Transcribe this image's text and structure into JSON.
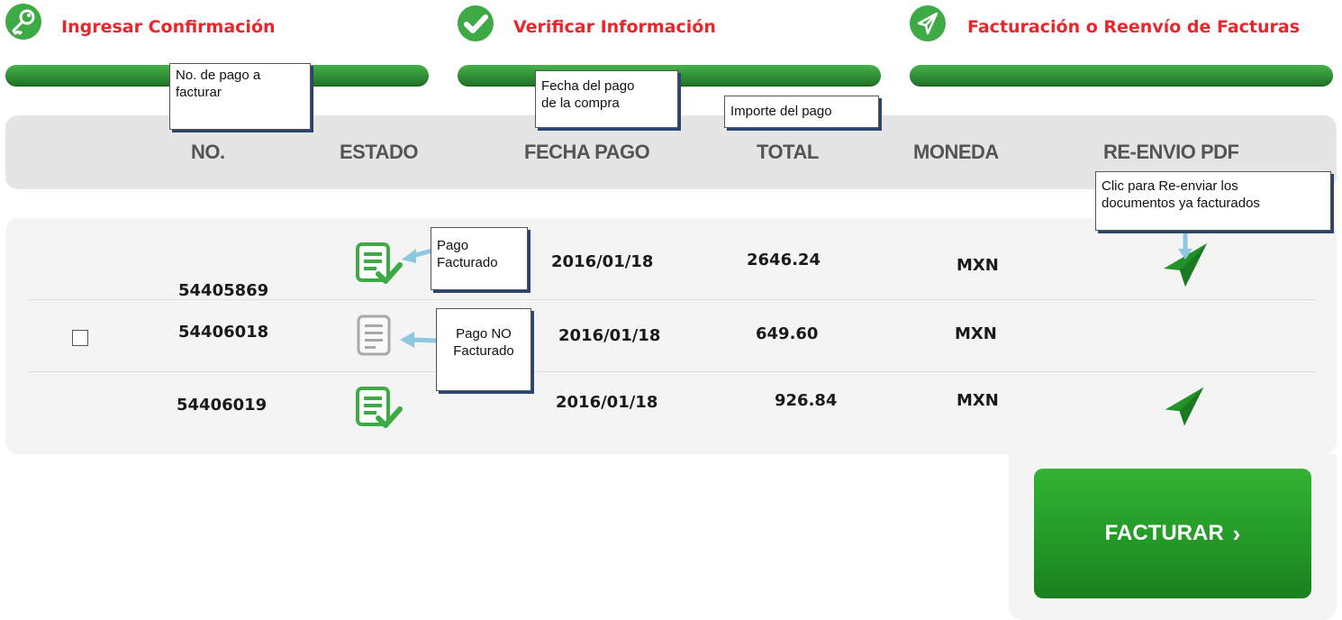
{
  "steps": [
    {
      "label": "Ingresar Confirmación",
      "icon": "key-icon"
    },
    {
      "label": "Verificar Información",
      "icon": "checkmark-icon"
    },
    {
      "label": "Facturación o Reenvío de Facturas",
      "icon": "paper-plane-icon"
    }
  ],
  "columns": {
    "no": "NO.",
    "estado": "ESTADO",
    "fecha": "FECHA PAGO",
    "total": "TOTAL",
    "moneda": "MONEDA",
    "reenvio": "RE-ENVIO PDF"
  },
  "rows": [
    {
      "no": "54405869",
      "estado": "facturado",
      "fecha": "2016/01/18",
      "total": "2646.24",
      "moneda": "MXN",
      "checkbox": false,
      "resend": true
    },
    {
      "no": "54406018",
      "estado": "no-facturado",
      "fecha": "2016/01/18",
      "total": "649.60",
      "moneda": "MXN",
      "checkbox": true,
      "resend": false
    },
    {
      "no": "54406019",
      "estado": "facturado",
      "fecha": "2016/01/18",
      "total": "926.84",
      "moneda": "MXN",
      "checkbox": false,
      "resend": true
    }
  ],
  "callouts": {
    "no_pago": {
      "line1": "No. de pago a",
      "line2": "facturar"
    },
    "fecha_pago": {
      "line1": "Fecha del pago",
      "line2": "de la compra"
    },
    "importe": {
      "line1": "Importe del pago"
    },
    "reenviar": {
      "line1": "Clic para Re-enviar los",
      "line2": "documentos ya facturados"
    },
    "facturado": {
      "line1": "Pago",
      "line2": "Facturado"
    },
    "no_facturado": {
      "line1": "Pago NO",
      "line2": "Facturado"
    }
  },
  "button": {
    "label": "FACTURAR",
    "chevron": "›"
  },
  "colors": {
    "accent_red": "#e8262b",
    "green": "#3daa45",
    "header_bg": "#e5e5e5",
    "table_bg": "#f4f4f4",
    "callout_arrow": "#8ec8e0"
  }
}
